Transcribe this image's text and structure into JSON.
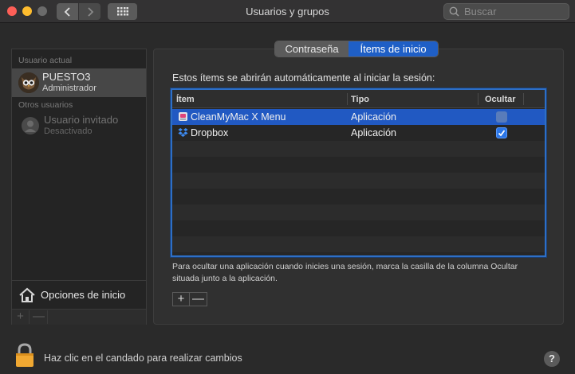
{
  "window": {
    "title": "Usuarios y grupos"
  },
  "search": {
    "placeholder": "Buscar"
  },
  "sidebar": {
    "current_user_header": "Usuario actual",
    "current_user": {
      "name": "PUESTO3",
      "role": "Administrador"
    },
    "other_users_header": "Otros usuarios",
    "guest": {
      "name": "Usuario invitado",
      "status": "Desactivado"
    },
    "login_options_label": "Opciones de inicio",
    "add_label": "+",
    "remove_label": "—"
  },
  "tabs": [
    {
      "label": "Contraseña",
      "selected": false
    },
    {
      "label": "Ítems de inicio",
      "selected": true
    }
  ],
  "main": {
    "intro": "Estos ítems se abrirán automáticamente al iniciar la sesión:",
    "columns": [
      "Ítem",
      "Tipo",
      "Ocultar"
    ],
    "rows": [
      {
        "item": "CleanMyMac X Menu",
        "type": "Aplicación",
        "hide": false,
        "selected": true,
        "icon": "cleanmymac-icon"
      },
      {
        "item": "Dropbox",
        "type": "Aplicación",
        "hide": true,
        "selected": false,
        "icon": "dropbox-icon"
      }
    ],
    "help_note": "Para ocultar una aplicación cuando inicies una sesión, marca la casilla de la columna Ocultar situada junto a la aplicación.",
    "add_label": "+",
    "remove_label": "—"
  },
  "footer": {
    "lock_text": "Haz clic en el candado para realizar cambios",
    "help_label": "?"
  },
  "colors": {
    "accent": "#2159c2",
    "selection": "#2159c2",
    "close": "#fe5f57",
    "minimize": "#febc2e"
  }
}
